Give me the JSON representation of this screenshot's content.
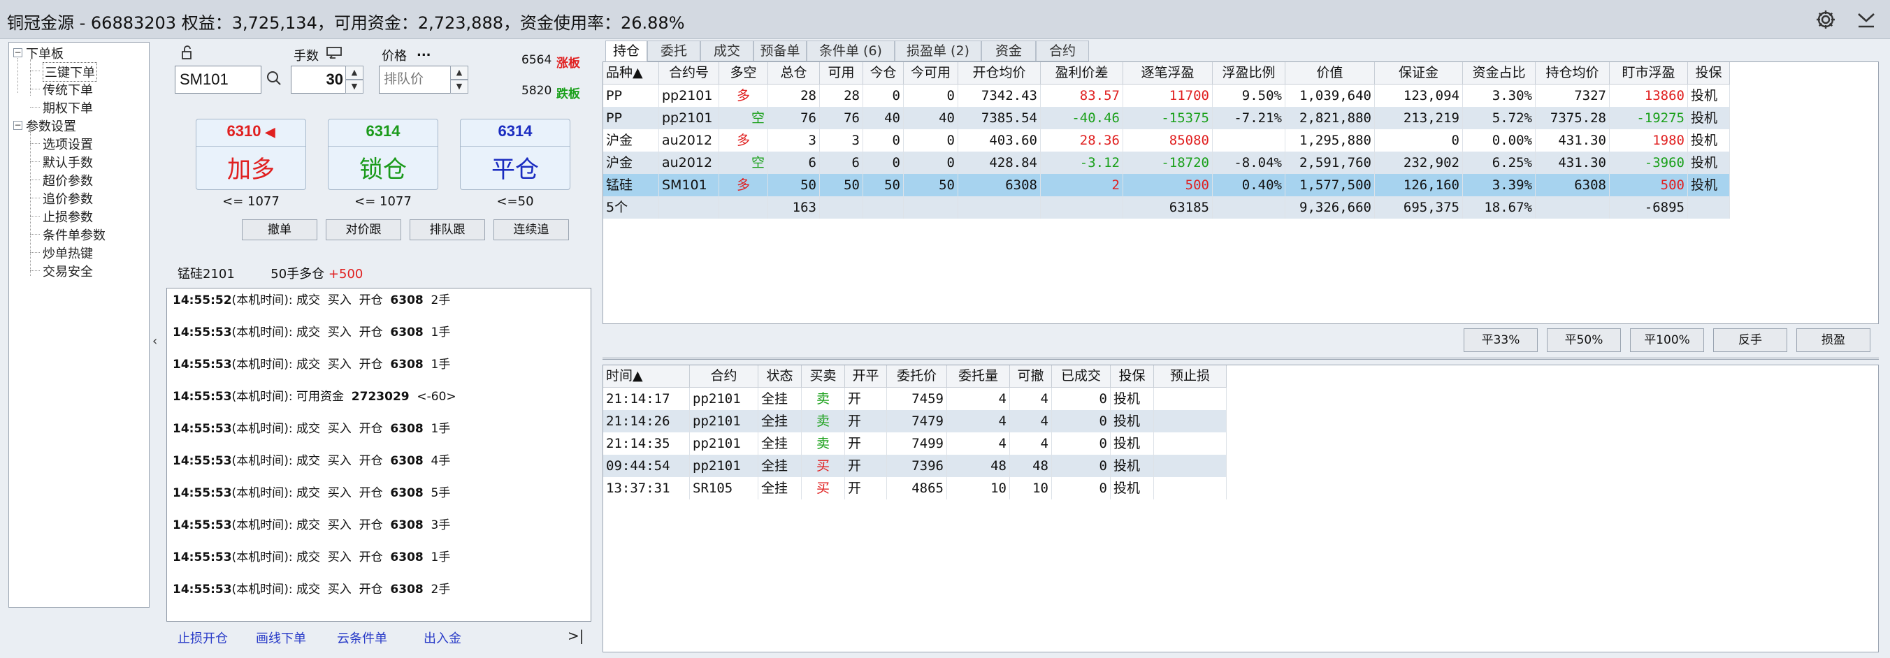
{
  "title": "铜冠金源 - 66883203  权益：3,725,134，可用资金：2,723,888，资金使用率：26.88%",
  "tree": {
    "group1": "下单板",
    "group1_items": [
      "三键下单",
      "传统下单",
      "期权下单"
    ],
    "group2": "参数设置",
    "group2_items": [
      "选项设置",
      "默认手数",
      "超价参数",
      "追价参数",
      "止损参数",
      "条件单参数",
      "炒单热键",
      "交易安全"
    ]
  },
  "order": {
    "symbol": "SM101",
    "qty_label": "手数",
    "qty": "30",
    "price_label": "价格",
    "price_dots": "...",
    "price_placeholder": "排队价",
    "limit_up": "6564",
    "limit_up_label": "涨板",
    "limit_down": "5820",
    "limit_down_label": "跌板",
    "buy_price": "6310",
    "buy_label": "加多",
    "buy_limit": "<= 1077",
    "lock_price": "6314",
    "lock_label": "锁仓",
    "lock_limit": "<= 1077",
    "close_price": "6314",
    "close_label": "平仓",
    "close_limit": "<=50",
    "btn_cancel": "撤单",
    "btn_counter": "对价跟",
    "btn_queue": "排队跟",
    "btn_chase": "连续追"
  },
  "info": {
    "name": "锰硅2101",
    "pos": "50手多仓",
    "pnl": "+500"
  },
  "log": [
    {
      "time": "14:55:52",
      "tag": "(本机时间)",
      "msg": ": 成交  买入  开仓  ",
      "price": "6308",
      "qty": "2手"
    },
    {
      "time": "14:55:53",
      "tag": "(本机时间)",
      "msg": ": 成交  买入  开仓  ",
      "price": "6308",
      "qty": "1手"
    },
    {
      "time": "14:55:53",
      "tag": "(本机时间)",
      "msg": ": 成交  买入  开仓  ",
      "price": "6308",
      "qty": "1手"
    },
    {
      "time": "14:55:53",
      "tag": "(本机时间)",
      "msg": ": 可用资金  ",
      "price": "2723029",
      "qty": "<-60>"
    },
    {
      "time": "14:55:53",
      "tag": "(本机时间)",
      "msg": ": 成交  买入  开仓  ",
      "price": "6308",
      "qty": "1手"
    },
    {
      "time": "14:55:53",
      "tag": "(本机时间)",
      "msg": ": 成交  买入  开仓  ",
      "price": "6308",
      "qty": "4手"
    },
    {
      "time": "14:55:53",
      "tag": "(本机时间)",
      "msg": ": 成交  买入  开仓  ",
      "price": "6308",
      "qty": "5手"
    },
    {
      "time": "14:55:53",
      "tag": "(本机时间)",
      "msg": ": 成交  买入  开仓  ",
      "price": "6308",
      "qty": "3手"
    },
    {
      "time": "14:55:53",
      "tag": "(本机时间)",
      "msg": ": 成交  买入  开仓  ",
      "price": "6308",
      "qty": "1手"
    },
    {
      "time": "14:55:53",
      "tag": "(本机时间)",
      "msg": ": 成交  买入  开仓  ",
      "price": "6308",
      "qty": "2手"
    }
  ],
  "links": [
    "止损开仓",
    "画线下单",
    "云条件单",
    "出入金"
  ],
  "end_icon": ">|",
  "tabs": [
    "持仓",
    "委托",
    "成交",
    "预备单",
    "条件单 (6)",
    "损盈单 (2)",
    "资金",
    "合约"
  ],
  "positions": {
    "headers": [
      "品种▲",
      "合约号",
      "多空",
      "总仓",
      "可用",
      "今仓",
      "今可用",
      "开仓均价",
      "盈利价差",
      "逐笔浮盈",
      "浮盈比例",
      "价值",
      "保证金",
      "资金占比",
      "持仓均价",
      "盯市浮盈",
      "投保"
    ],
    "rows": [
      [
        "PP",
        "pp2101",
        "多",
        "28",
        "28",
        "0",
        "0",
        "7342.43",
        "83.57",
        "11700",
        "9.50%",
        "1,039,640",
        "123,094",
        "3.30%",
        "7327",
        "13860",
        "投机"
      ],
      [
        "PP",
        "pp2101",
        "空",
        "76",
        "76",
        "40",
        "40",
        "7385.54",
        "-40.46",
        "-15375",
        "-7.21%",
        "2,821,880",
        "213,219",
        "5.72%",
        "7375.28",
        "-19275",
        "投机"
      ],
      [
        "沪金",
        "au2012",
        "多",
        "3",
        "3",
        "0",
        "0",
        "403.60",
        "28.36",
        "85080",
        "",
        "1,295,880",
        "0",
        "0.00%",
        "431.30",
        "1980",
        "投机"
      ],
      [
        "沪金",
        "au2012",
        "空",
        "6",
        "6",
        "0",
        "0",
        "428.84",
        "-3.12",
        "-18720",
        "-8.04%",
        "2,591,760",
        "232,902",
        "6.25%",
        "431.30",
        "-3960",
        "投机"
      ],
      [
        "锰硅",
        "SM101",
        "多",
        "50",
        "50",
        "50",
        "50",
        "6308",
        "2",
        "500",
        "0.40%",
        "1,577,500",
        "126,160",
        "3.39%",
        "6308",
        "500",
        "投机"
      ],
      [
        "5个",
        "",
        "",
        "163",
        "",
        "",
        "",
        "",
        "",
        "63185",
        "",
        "9,326,660",
        "695,375",
        "18.67%",
        "",
        "-6895",
        ""
      ]
    ]
  },
  "action_buttons": [
    "平33%",
    "平50%",
    "平100%",
    "反手",
    "损盈"
  ],
  "orders": {
    "headers": [
      "时间▲",
      "合约",
      "状态",
      "买卖",
      "开平",
      "委托价",
      "委托量",
      "可撤",
      "已成交",
      "投保",
      "预止损"
    ],
    "rows": [
      [
        "21:14:17",
        "pp2101",
        "全挂",
        "卖",
        "开",
        "7459",
        "4",
        "4",
        "0",
        "投机",
        ""
      ],
      [
        "21:14:26",
        "pp2101",
        "全挂",
        "卖",
        "开",
        "7479",
        "4",
        "4",
        "0",
        "投机",
        ""
      ],
      [
        "21:14:35",
        "pp2101",
        "全挂",
        "卖",
        "开",
        "7499",
        "4",
        "4",
        "0",
        "投机",
        ""
      ],
      [
        "09:44:54",
        "pp2101",
        "全挂",
        "买",
        "开",
        "7396",
        "48",
        "48",
        "0",
        "投机",
        ""
      ],
      [
        "13:37:31",
        "SR105",
        "全挂",
        "买",
        "开",
        "4865",
        "10",
        "10",
        "0",
        "投机",
        ""
      ]
    ]
  },
  "colors": {
    "red": "#e02020",
    "green": "#1aa01a",
    "highlight": "#a7d3ef",
    "blue": "#1a2cc0"
  }
}
